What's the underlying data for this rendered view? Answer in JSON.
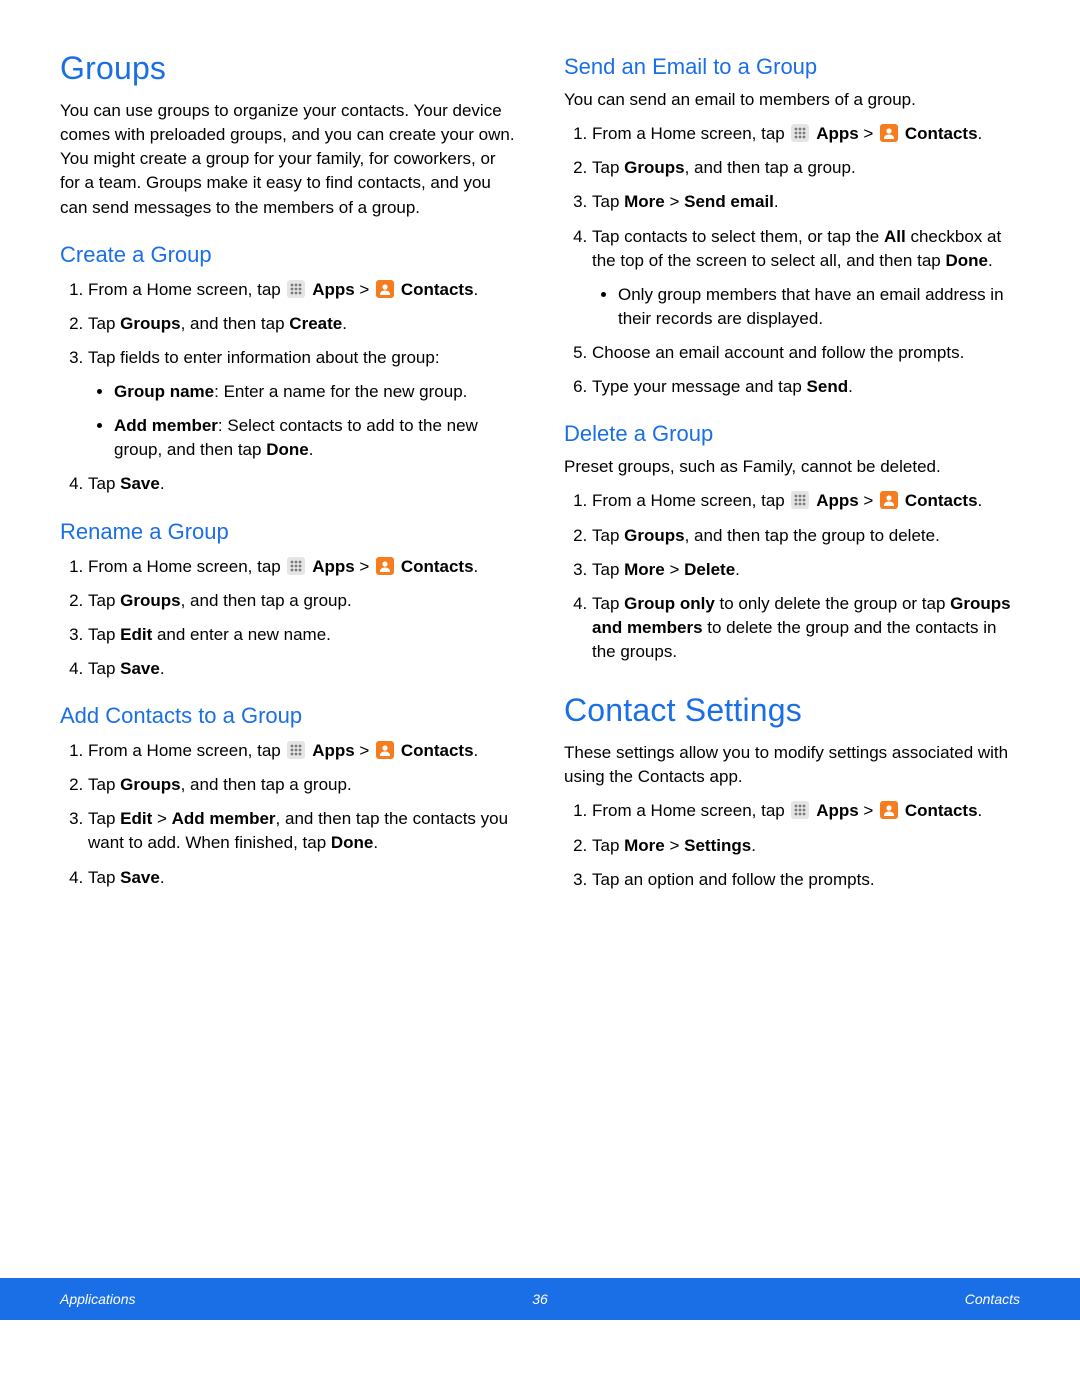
{
  "ui": {
    "apps_label": "Apps",
    "contacts_label": "Contacts"
  },
  "left": {
    "h1": "Groups",
    "intro": "You can use groups to organize your contacts. Your device comes with preloaded groups, and you can create your own. You might create a group for your family, for coworkers, or for a team. Groups make it easy to find contacts, and you can send messages to the members of a group.",
    "create": {
      "h": "Create a Group",
      "s1a": "From a Home screen, tap ",
      "s1b": " > ",
      "s1c": ".",
      "s2": {
        "t1": "Tap ",
        "b1": "Groups",
        "t2": ", and then tap ",
        "b2": "Create",
        "t3": "."
      },
      "s3": "Tap fields to enter information about the group:",
      "b1": {
        "b": "Group name",
        "t": ": Enter a name for the new group."
      },
      "b2": {
        "b": "Add member",
        "t": ": Select contacts to add to the new group, and then tap ",
        "b2": "Done",
        "t2": "."
      },
      "s4": {
        "t1": "Tap ",
        "b1": "Save",
        "t2": "."
      }
    },
    "rename": {
      "h": "Rename a Group",
      "s1a": "From a Home screen, tap ",
      "s1b": " > ",
      "s1c": ".",
      "s2": {
        "t1": "Tap ",
        "b1": "Groups",
        "t2": ", and then tap a group."
      },
      "s3": {
        "t1": "Tap ",
        "b1": "Edit",
        "t2": " and enter a new name."
      },
      "s4": {
        "t1": "Tap ",
        "b1": "Save",
        "t2": "."
      }
    },
    "add": {
      "h": "Add Contacts to a Group",
      "s1a": "From a Home screen, tap ",
      "s1b": " > ",
      "s1c": ".",
      "s2": {
        "t1": "Tap ",
        "b1": "Groups",
        "t2": ", and then tap a group."
      },
      "s3": {
        "t1": "Tap ",
        "b1": "Edit",
        "t2": " > ",
        "b2": "Add member",
        "t3": ", and then tap the contacts you want to add. When finished, tap ",
        "b3": "Done",
        "t4": "."
      },
      "s4": {
        "t1": "Tap ",
        "b1": "Save",
        "t2": "."
      }
    }
  },
  "right": {
    "send": {
      "h": "Send an Email to a Group",
      "intro": "You can send an email to members of a group.",
      "s1a": "From a Home screen, tap ",
      "s1b": " > ",
      "s1c": ".",
      "s2": {
        "t1": "Tap ",
        "b1": "Groups",
        "t2": ", and then tap a group."
      },
      "s3": {
        "t1": "Tap ",
        "b1": "More",
        "t2": " > ",
        "b2": "Send email",
        "t3": "."
      },
      "s4": {
        "t1": "Tap contacts to select them, or tap the ",
        "b1": "All",
        "t2": " checkbox at the top of the screen to select all, and then tap ",
        "b2": "Done",
        "t3": "."
      },
      "b1": "Only group members that have an email address in their records are displayed.",
      "s5": "Choose an email account and follow the prompts.",
      "s6": {
        "t1": "Type your message and tap ",
        "b1": "Send",
        "t2": "."
      }
    },
    "del": {
      "h": "Delete a Group",
      "intro": "Preset groups, such as Family, cannot be deleted.",
      "s1a": "From a Home screen, tap ",
      "s1b": " > ",
      "s1c": ".",
      "s2": {
        "t1": "Tap ",
        "b1": "Groups",
        "t2": ", and then tap the group to delete."
      },
      "s3": {
        "t1": "Tap ",
        "b1": "More",
        "t2": " > ",
        "b2": "Delete",
        "t3": "."
      },
      "s4": {
        "t1": "Tap ",
        "b1": "Group only",
        "t2": " to only delete the group or tap ",
        "b2": "Groups and members",
        "t3": " to delete the group and the contacts in the groups."
      }
    },
    "settings": {
      "h1": "Contact Settings",
      "intro": "These settings allow you to modify settings associated with using the Contacts app.",
      "s1a": "From a Home screen, tap ",
      "s1b": " > ",
      "s1c": ".",
      "s2": {
        "t1": "Tap ",
        "b1": "More",
        "t2": " > ",
        "b2": "Settings",
        "t3": "."
      },
      "s3": "Tap an option and follow the prompts."
    }
  },
  "footer": {
    "left": "Applications",
    "center": "36",
    "right": "Contacts"
  }
}
